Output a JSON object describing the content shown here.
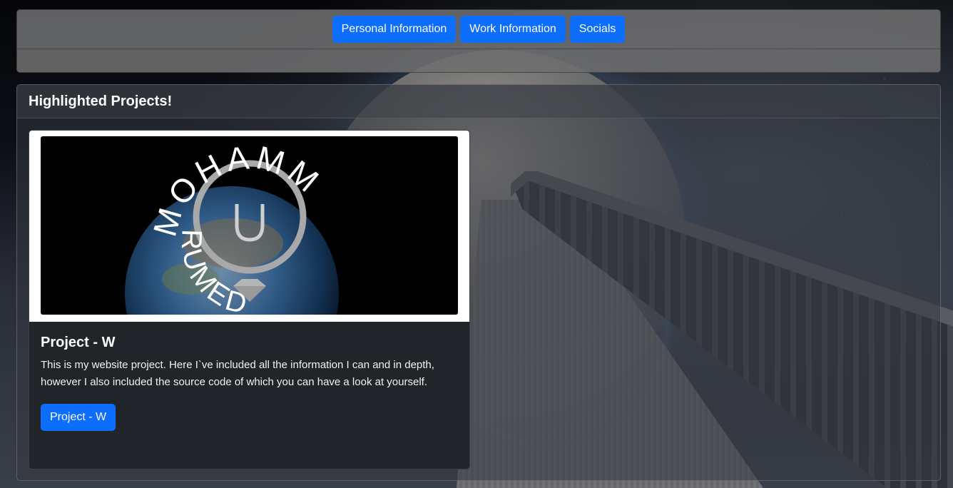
{
  "nav": {
    "buttons": [
      {
        "label": "Personal Information"
      },
      {
        "label": "Work Information"
      },
      {
        "label": "Socials"
      }
    ]
  },
  "projects": {
    "header": "Highlighted Projects!",
    "items": [
      {
        "title": "Project - W",
        "description": "This is my website project. Here I`ve included all the information I can and in depth, however I also included the source code of which you can have a look at yourself.",
        "button_label": "Project - W",
        "logo_text": "MOHAMMEDUMER",
        "logo_letter": "U"
      }
    ]
  },
  "colors": {
    "accent": "#0d6efd",
    "card_dark": "#212529"
  }
}
